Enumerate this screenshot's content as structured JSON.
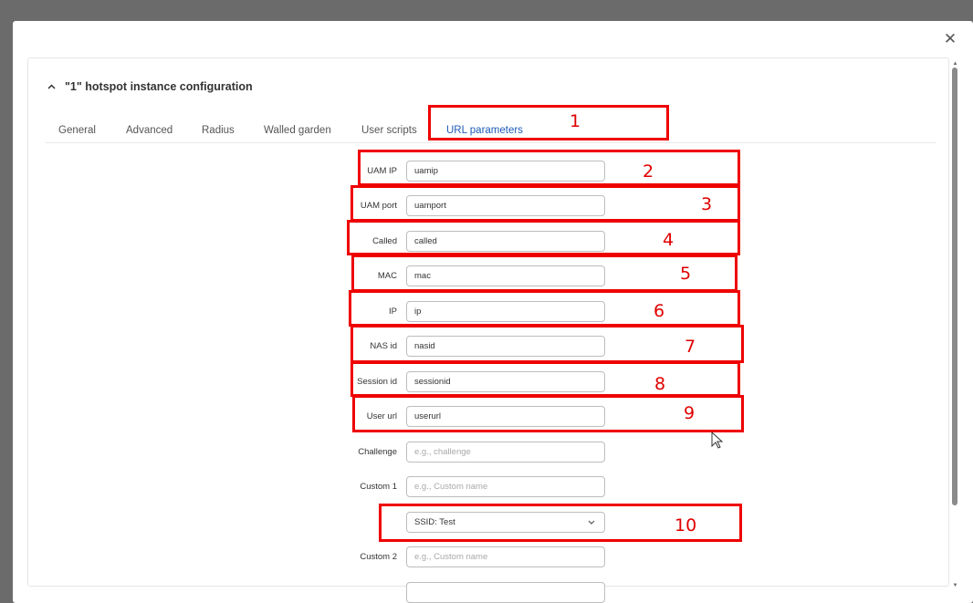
{
  "modal": {
    "close_symbol": "✕",
    "section": {
      "chevron_icon": "chevron-up-icon",
      "title": "\"1\" hotspot instance configuration"
    },
    "tabs": [
      {
        "label": "General",
        "active": false
      },
      {
        "label": "Advanced",
        "active": false
      },
      {
        "label": "Radius",
        "active": false
      },
      {
        "label": "Walled garden",
        "active": false
      },
      {
        "label": "User scripts",
        "active": false
      },
      {
        "label": "URL parameters",
        "active": true
      }
    ],
    "fields": [
      {
        "label": "UAM IP",
        "value": "uamip",
        "placeholder": ""
      },
      {
        "label": "UAM port",
        "value": "uamport",
        "placeholder": ""
      },
      {
        "label": "Called",
        "value": "called",
        "placeholder": ""
      },
      {
        "label": "MAC",
        "value": "mac",
        "placeholder": ""
      },
      {
        "label": "IP",
        "value": "ip",
        "placeholder": ""
      },
      {
        "label": "NAS id",
        "value": "nasid",
        "placeholder": ""
      },
      {
        "label": "Session id",
        "value": "sessionid",
        "placeholder": ""
      },
      {
        "label": "User url",
        "value": "userurl",
        "placeholder": ""
      },
      {
        "label": "Challenge",
        "value": "",
        "placeholder": "e.g., challenge"
      },
      {
        "label": "Custom 1",
        "value": "",
        "placeholder": "e.g., Custom name"
      },
      {
        "label": "",
        "select_value": "SSID: Test"
      },
      {
        "label": "Custom 2",
        "value": "",
        "placeholder": "e.g., Custom name"
      }
    ]
  },
  "annotations": {
    "color": "#ef0000",
    "numbers": [
      "1",
      "2",
      "3",
      "4",
      "5",
      "6",
      "7",
      "8",
      "9",
      "10"
    ]
  }
}
